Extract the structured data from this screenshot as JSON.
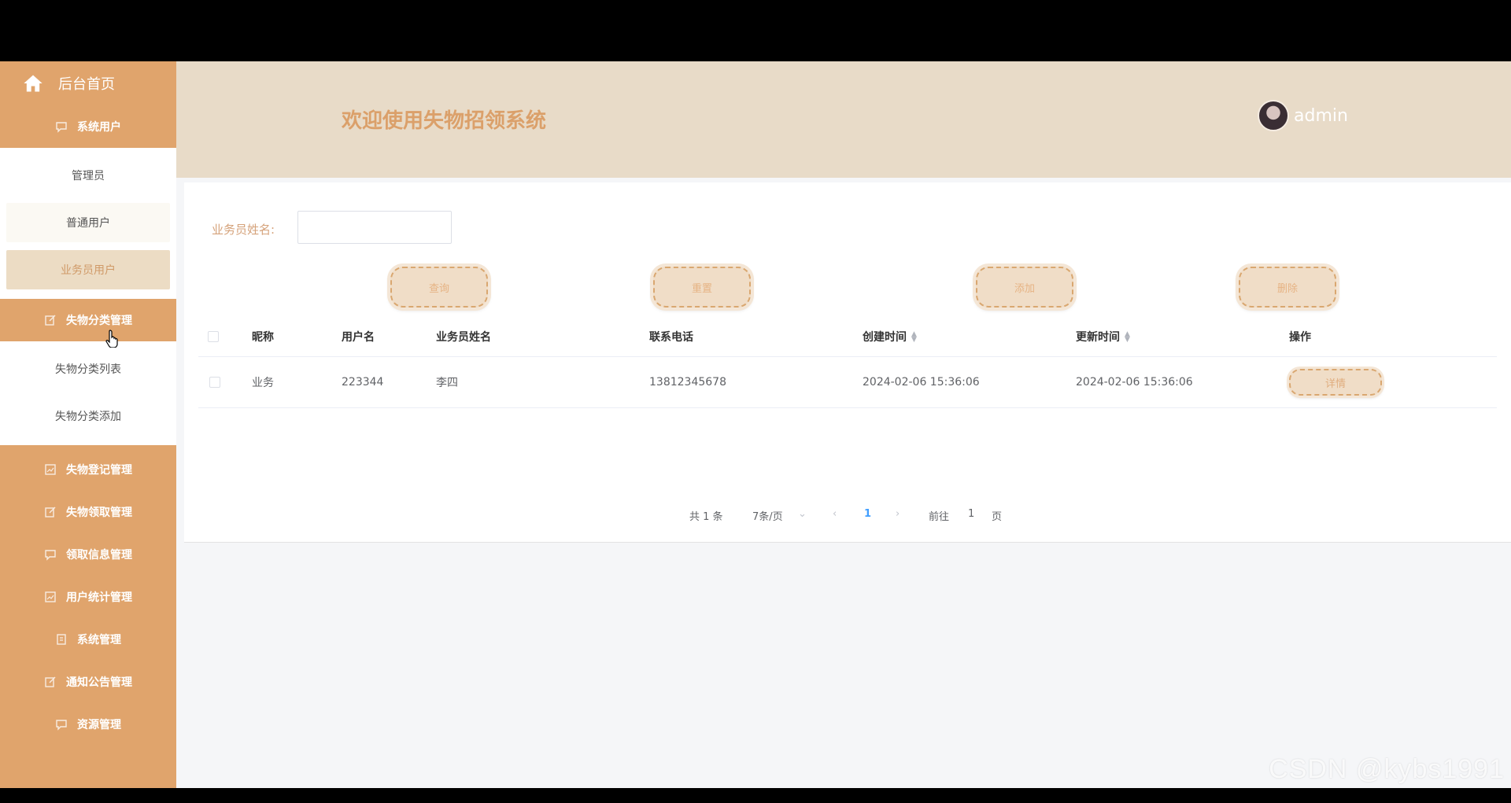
{
  "sidebar": {
    "home_label": "后台首页",
    "groups": [
      {
        "label": "系统用户",
        "icon": "chat-icon",
        "items": [
          "管理员",
          "普通用户",
          "业务员用户"
        ]
      },
      {
        "label": "失物分类管理",
        "icon": "edit-icon",
        "items": [
          "失物分类列表",
          "失物分类添加"
        ]
      },
      {
        "label": "失物登记管理",
        "icon": "chart-icon",
        "items": []
      },
      {
        "label": "失物领取管理",
        "icon": "edit-icon",
        "items": []
      },
      {
        "label": "领取信息管理",
        "icon": "chat-icon",
        "items": []
      },
      {
        "label": "用户统计管理",
        "icon": "chart-icon",
        "items": []
      },
      {
        "label": "系统管理",
        "icon": "doc-icon",
        "items": []
      },
      {
        "label": "通知公告管理",
        "icon": "edit-icon",
        "items": []
      },
      {
        "label": "资源管理",
        "icon": "chat-icon",
        "items": []
      }
    ]
  },
  "header": {
    "title": "欢迎使用失物招领系统",
    "username": "admin"
  },
  "search": {
    "label": "业务员姓名:",
    "value": "",
    "placeholder": ""
  },
  "buttons": {
    "query": "查询",
    "reset": "重置",
    "add": "添加",
    "delete": "删除"
  },
  "table": {
    "columns": [
      "昵称",
      "用户名",
      "业务员姓名",
      "联系电话",
      "创建时间",
      "更新时间",
      "操作"
    ],
    "rows": [
      {
        "nickname": "业务",
        "username": "223344",
        "name": "李四",
        "phone": "13812345678",
        "created": "2024-02-06 15:36:06",
        "updated": "2024-02-06 15:36:06",
        "action": "详情"
      }
    ]
  },
  "pagination": {
    "total": "共 1 条",
    "page_size": "7条/页",
    "current_page": "1",
    "goto_label": "前往",
    "goto_value": "1",
    "page_unit": "页"
  },
  "watermark": "CSDN @kybs1991",
  "colors": {
    "sidebar": "#e0a46c",
    "header": "#e8dbc8",
    "accent": "#dba06a"
  }
}
